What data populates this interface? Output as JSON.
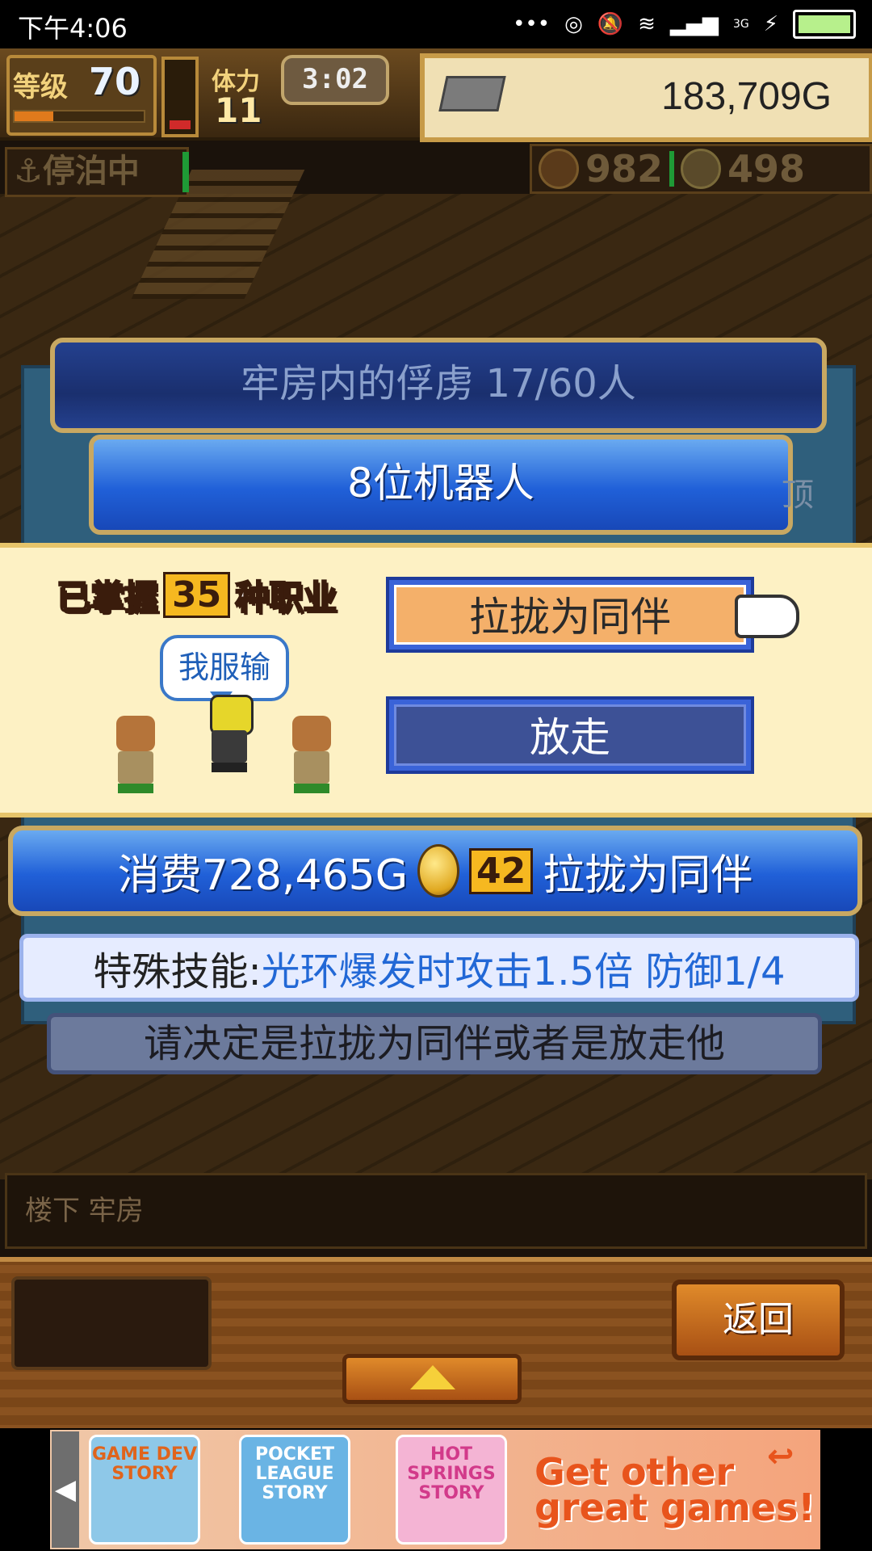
{
  "status_bar": {
    "time": "下午4:06",
    "network": "3G"
  },
  "hud": {
    "level_label": "等级",
    "level": "70",
    "level_progress": 0.3,
    "stamina_label": "体力",
    "stamina": "11",
    "gauge_fill": 0.25,
    "timer": "3:02",
    "gold": "183,709G",
    "status": "停泊中",
    "food": "982",
    "medals": "498"
  },
  "dialog": {
    "title": "牢房内的俘虏  17/60人",
    "subtitle": "8位机器人",
    "side_text": "顶"
  },
  "popup": {
    "mastered_prefix": "已掌握",
    "mastered_count": "35",
    "mastered_suffix": "种职业",
    "speech": "我服输",
    "recruit_button": "拉拢为同伴",
    "release_button": "放走"
  },
  "cost": {
    "text": "消费728,465G",
    "coins": "42",
    "action": "拉拢为同伴"
  },
  "skill": {
    "label": "特殊技能:",
    "value": "光环爆发时攻击1.5倍 防御1/4"
  },
  "prompt": "请决定是拉拢为同伴或者是放走他",
  "location": "楼下 牢房",
  "bottom": {
    "back_button": "返回"
  },
  "ad": {
    "tiles": [
      "GAME DEV STORY",
      "POCKET LEAGUE STORY",
      "HOT SPRINGS STORY"
    ],
    "tagline_1": "Get other",
    "tagline_2": "great games!"
  },
  "colors": {
    "recruit_fill": "#f4b06a",
    "button_blue": "#3a63d8",
    "skill_text": "#2268d6",
    "popup_bg": "#fdf1c4"
  }
}
